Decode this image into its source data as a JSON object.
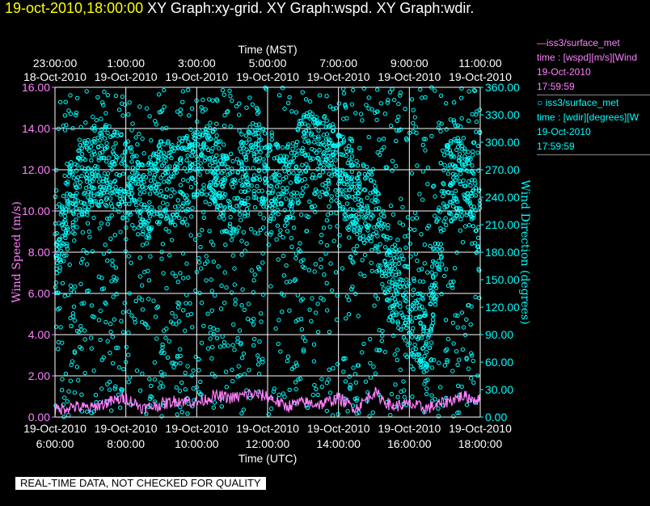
{
  "title": {
    "timestamp": "19-oct-2010,18:00:00",
    "graphs": "XY Graph:xy-grid.  XY Graph:wspd.  XY Graph:wdir."
  },
  "legend": {
    "wspd": {
      "line1": "—iss3/surface_met",
      "line2": "time : [wspd][m/s][Wind",
      "line3": "19-Oct-2010",
      "line4": "17:59:59"
    },
    "wdir": {
      "line1": "○ iss3/surface_met",
      "line2": "time : [wdir][degrees][W",
      "line3": "19-Oct-2010",
      "line4": "17:59:59"
    }
  },
  "footer": {
    "qc_notice": "REAL-TIME DATA, NOT CHECKED FOR QUALITY"
  },
  "colors": {
    "wspd": "#ff80ff",
    "wdir": "#00ffff",
    "background": "#000000",
    "grid": "#ffffff",
    "timestamp": "#ffff00"
  },
  "chart_data": {
    "type": "scatter",
    "top_axis": {
      "label": "Time (MST)",
      "ticks": [
        {
          "time": "23:00:00",
          "date": "18-Oct-2010"
        },
        {
          "time": "1:00:00",
          "date": "19-Oct-2010"
        },
        {
          "time": "3:00:00",
          "date": "19-Oct-2010"
        },
        {
          "time": "5:00:00",
          "date": "19-Oct-2010"
        },
        {
          "time": "7:00:00",
          "date": "19-Oct-2010"
        },
        {
          "time": "9:00:00",
          "date": "19-Oct-2010"
        },
        {
          "time": "11:00:00",
          "date": "19-Oct-2010"
        }
      ]
    },
    "bottom_axis": {
      "label": "Time (UTC)",
      "ticks": [
        {
          "date": "19-Oct-2010",
          "time": "6:00:00"
        },
        {
          "date": "19-Oct-2010",
          "time": "8:00:00"
        },
        {
          "date": "19-Oct-2010",
          "time": "10:00:00"
        },
        {
          "date": "19-Oct-2010",
          "time": "12:00:00"
        },
        {
          "date": "19-Oct-2010",
          "time": "14:00:00"
        },
        {
          "date": "19-Oct-2010",
          "time": "16:00:00"
        },
        {
          "date": "19-Oct-2010",
          "time": "18:00:00"
        }
      ],
      "range_hours_utc": [
        6,
        18
      ]
    },
    "left_axis": {
      "label": "Wind Speed (m/s)",
      "ticks": [
        "0.00",
        "2.00",
        "4.00",
        "6.00",
        "8.00",
        "10.00",
        "12.00",
        "14.00",
        "16.00"
      ],
      "range": [
        0,
        16
      ]
    },
    "right_axis": {
      "label": "Wind Direction (degrees)",
      "ticks": [
        "0.00",
        "30.00",
        "60.00",
        "90.00",
        "120.00",
        "150.00",
        "180.00",
        "210.00",
        "240.00",
        "270.00",
        "300.00",
        "330.00",
        "360.00"
      ],
      "range": [
        0,
        360
      ]
    },
    "grid": true,
    "series": [
      {
        "name": "iss3/surface_met wspd",
        "axis": "left",
        "style": "line",
        "x_hours_utc": [
          6.0,
          6.5,
          7.0,
          7.5,
          8.0,
          8.5,
          9.0,
          9.5,
          10.0,
          10.5,
          11.0,
          11.5,
          12.0,
          12.5,
          13.0,
          13.5,
          14.0,
          14.5,
          15.0,
          15.5,
          16.0,
          16.5,
          17.0,
          17.5,
          18.0
        ],
        "values": [
          0.2,
          0.4,
          0.3,
          0.6,
          0.8,
          0.3,
          0.5,
          0.7,
          0.6,
          0.9,
          0.8,
          1.0,
          0.9,
          0.4,
          0.6,
          0.5,
          0.8,
          0.3,
          1.1,
          0.4,
          0.5,
          0.3,
          0.6,
          0.9,
          0.7
        ]
      },
      {
        "name": "iss3/surface_met wdir",
        "axis": "right",
        "style": "points",
        "x_hours_utc": [
          6.0,
          6.5,
          7.0,
          7.5,
          8.0,
          8.5,
          9.0,
          9.5,
          10.0,
          10.5,
          11.0,
          11.5,
          12.0,
          12.5,
          13.0,
          13.5,
          14.0,
          14.5,
          15.0,
          15.5,
          16.0,
          16.5,
          17.0,
          17.5,
          18.0
        ],
        "values": [
          180,
          240,
          270,
          275,
          260,
          230,
          260,
          250,
          280,
          270,
          230,
          280,
          270,
          240,
          290,
          285,
          270,
          240,
          220,
          150,
          120,
          80,
          250,
          270,
          200
        ]
      }
    ]
  }
}
